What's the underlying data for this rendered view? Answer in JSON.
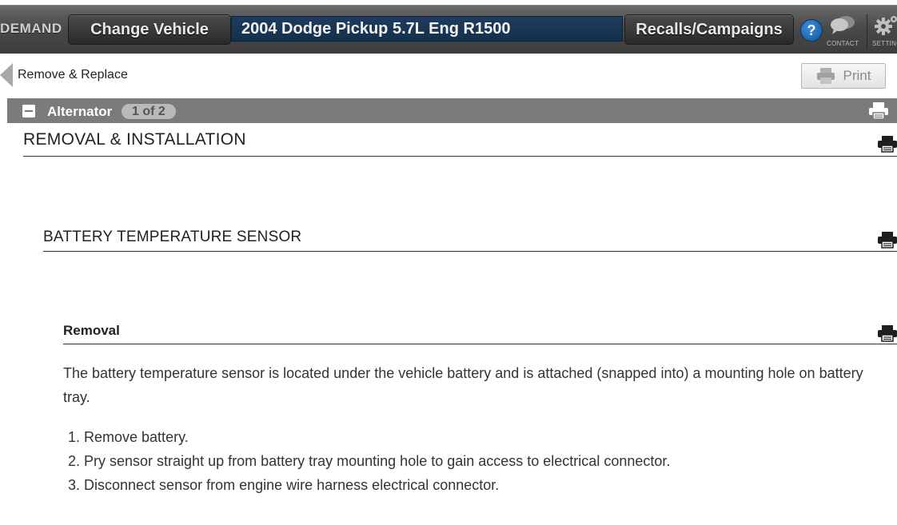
{
  "header": {
    "brand": "DEMAND",
    "change_vehicle_label": "Change Vehicle",
    "vehicle": "2004 Dodge Pickup 5.7L Eng R1500",
    "recalls_label": "Recalls/Campaigns",
    "help_label": "?",
    "contact_label": "CONTACT",
    "settings_label": "SETTING"
  },
  "breadcrumb": {
    "back_label": "Remove & Replace",
    "print_label": "Print"
  },
  "section": {
    "title": "Alternator",
    "count": "1 of 2"
  },
  "content": {
    "heading1": "REMOVAL & INSTALLATION",
    "heading2": "BATTERY TEMPERATURE SENSOR",
    "heading3": "Removal",
    "paragraph": "The battery temperature sensor is located under the vehicle battery and is attached (snapped into) a mounting hole on battery tray.",
    "steps": [
      "1. Remove battery.",
      "2. Pry sensor straight up from battery tray mounting hole to gain access to electrical connector.",
      "3. Disconnect sensor from engine wire harness electrical connector."
    ]
  },
  "icons": {
    "print": "printer-icon",
    "help": "question-icon",
    "contact": "chat-bubble-icon",
    "settings": "gear-icon",
    "back": "left-triangle-icon",
    "collapse": "minus-square-icon"
  },
  "colors": {
    "topbar": "#4a4a4a",
    "vehicle_box": "#1a3756",
    "help_blue": "#1f6ec0",
    "section_bar": "#7b7b7b"
  }
}
